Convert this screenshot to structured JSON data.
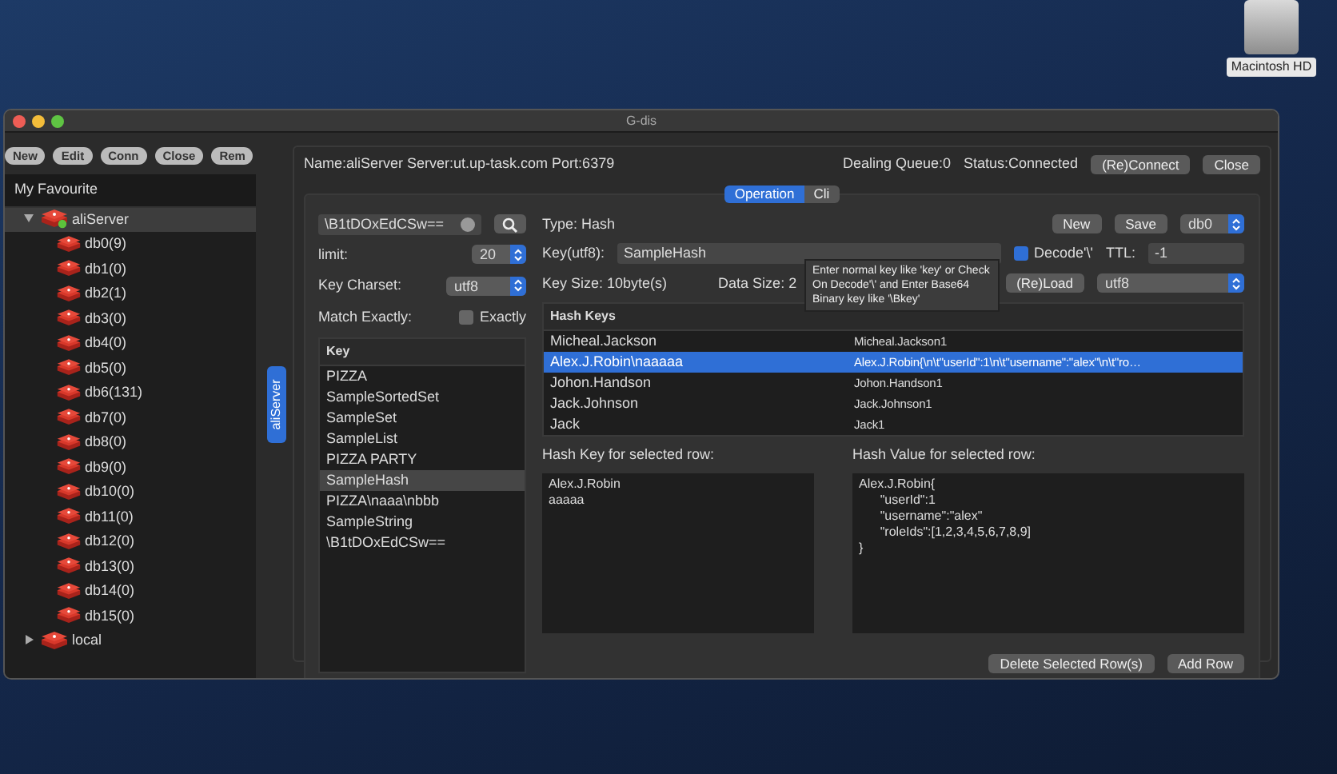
{
  "desktop_icon": {
    "label": "Macintosh HD"
  },
  "window": {
    "title": "G-dis"
  },
  "toolbar": [
    "New",
    "Edit",
    "Conn",
    "Close",
    "Rem"
  ],
  "tree": {
    "header": "My Favourite",
    "items": [
      {
        "label": "aliServer",
        "expanded": true,
        "selected": true,
        "connected": true,
        "children": [
          {
            "label": "db0(9)"
          },
          {
            "label": "db1(0)"
          },
          {
            "label": "db2(1)"
          },
          {
            "label": "db3(0)"
          },
          {
            "label": "db4(0)"
          },
          {
            "label": "db5(0)"
          },
          {
            "label": "db6(131)"
          },
          {
            "label": "db7(0)"
          },
          {
            "label": "db8(0)"
          },
          {
            "label": "db9(0)"
          },
          {
            "label": "db10(0)"
          },
          {
            "label": "db11(0)"
          },
          {
            "label": "db12(0)"
          },
          {
            "label": "db13(0)"
          },
          {
            "label": "db14(0)"
          },
          {
            "label": "db15(0)"
          }
        ]
      },
      {
        "label": "local",
        "expanded": false,
        "selected": false,
        "connected": false
      }
    ]
  },
  "side_tab": {
    "label": "aliServer",
    "selected": true
  },
  "header": {
    "info": "Name:aliServer Server:ut.up-task.com Port:6379",
    "queue": "Dealing Queue:0",
    "status": "Status:Connected",
    "buttons": [
      "(Re)Connect",
      "Close"
    ]
  },
  "tabs": [
    {
      "label": "Operation",
      "selected": true
    },
    {
      "label": "Cli",
      "selected": false
    }
  ],
  "search": {
    "value": "\\B1tDOxEdCSw=="
  },
  "limit": {
    "label": "limit:",
    "value": "20"
  },
  "charset": {
    "label": "Key Charset:",
    "value": "utf8"
  },
  "match": {
    "label": "Match Exactly:",
    "checkbox": "Exactly",
    "checked": false
  },
  "keys": {
    "column": "Key",
    "rows": [
      {
        "label": "PIZZA",
        "selected": false
      },
      {
        "label": "SampleSortedSet",
        "selected": false
      },
      {
        "label": "SampleSet",
        "selected": false
      },
      {
        "label": "SampleList",
        "selected": false
      },
      {
        "label": "PIZZA PARTY",
        "selected": false
      },
      {
        "label": "SampleHash",
        "selected": true
      },
      {
        "label": "PIZZA\\naaa\\nbbb",
        "selected": false
      },
      {
        "label": "SampleString",
        "selected": false
      },
      {
        "label": "\\B1tDOxEdCSw==",
        "selected": false
      }
    ]
  },
  "detail": {
    "type": "Type: Hash",
    "buttons": [
      "New",
      "Save"
    ],
    "db": "db0",
    "key_label": "Key(utf8):",
    "key_value": "SampleHash",
    "decode": {
      "label": "Decode'\\'",
      "checked": true
    },
    "ttl_label": "TTL:",
    "ttl": "-1",
    "key_size": "Key Size: 10byte(s)",
    "data_size": "Data Size: 2",
    "reload": "(Re)Load",
    "value_charset": "utf8"
  },
  "tooltip": "Enter normal key like 'key' or Check On Decode'\\' and Enter Base64 Binary key like '\\Bkey'",
  "hash_table": {
    "column": "Hash Keys",
    "rows": [
      {
        "key": "Micheal.Jackson",
        "value": "Micheal.Jackson1",
        "selected": false
      },
      {
        "key": "Alex.J.Robin\\naaaaa",
        "value": "Alex.J.Robin{\\n\\t\"userId\":1\\n\\t\"username\":\"alex\"\\n\\t\"ro…",
        "selected": true
      },
      {
        "key": "Johon.Handson",
        "value": "Johon.Handson1",
        "selected": false
      },
      {
        "key": "Jack.Johnson",
        "value": "Jack.Johnson1",
        "selected": false
      },
      {
        "key": "Jack",
        "value": "Jack1",
        "selected": false
      }
    ]
  },
  "selected_key": {
    "label": "Hash Key for selected row:",
    "text": "Alex.J.Robin\naaaaa"
  },
  "selected_value": {
    "label": "Hash Value for selected row:",
    "text": "Alex.J.Robin{\n\t\"userId\":1\n\t\"username\":\"alex\"\n\t\"roleIds\":[1,2,3,4,5,6,7,8,9]\n}"
  },
  "bottom_buttons": [
    "Delete Selected Row(s)",
    "Add Row"
  ]
}
